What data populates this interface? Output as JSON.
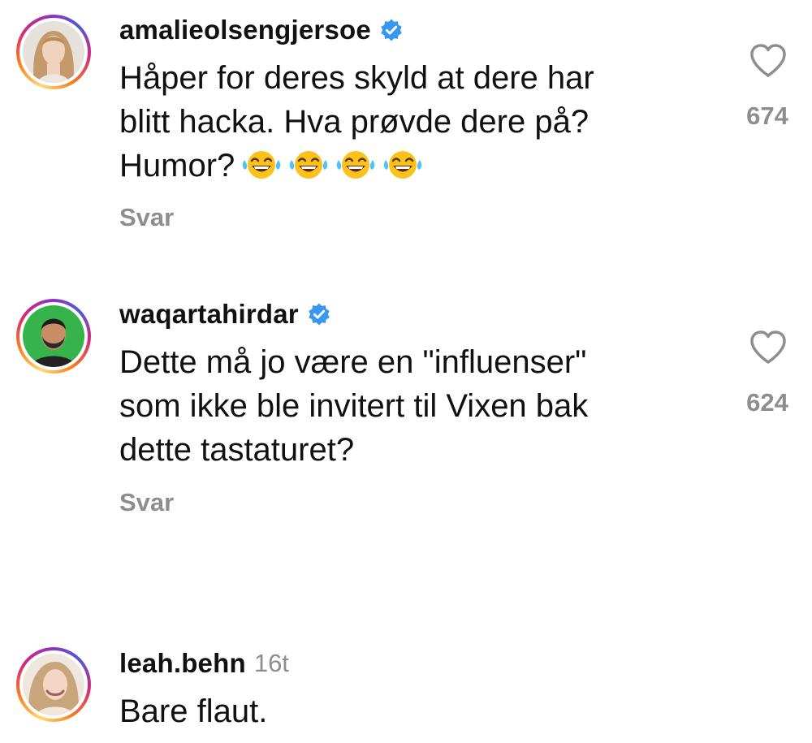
{
  "comments": [
    {
      "username": "amalieolsengjersoe",
      "verified": true,
      "text_lines": [
        "Håper for deres skyld at dere har",
        "blitt hacka. Hva prøvde dere på?",
        "Humor?"
      ],
      "emoji_count": 4,
      "emoji_icon": "face-with-tears-of-joy-icon",
      "reply_label": "Svar",
      "like_count": "674",
      "avatar_icon": "profile-photo"
    },
    {
      "username": "waqartahirdar",
      "verified": true,
      "text_lines": [
        "Dette må jo være en \"influenser\"",
        "som ikke ble invitert til Vixen bak",
        "dette tastaturet?"
      ],
      "reply_label": "Svar",
      "like_count": "624",
      "avatar_icon": "profile-photo"
    },
    {
      "username": "leah.behn",
      "timestamp": "16t",
      "text_lines": [
        "Bare flaut."
      ],
      "avatar_icon": "profile-photo"
    }
  ],
  "colors": {
    "text": "#111111",
    "secondary": "#8e8e8e",
    "verified": "#3897f0"
  }
}
